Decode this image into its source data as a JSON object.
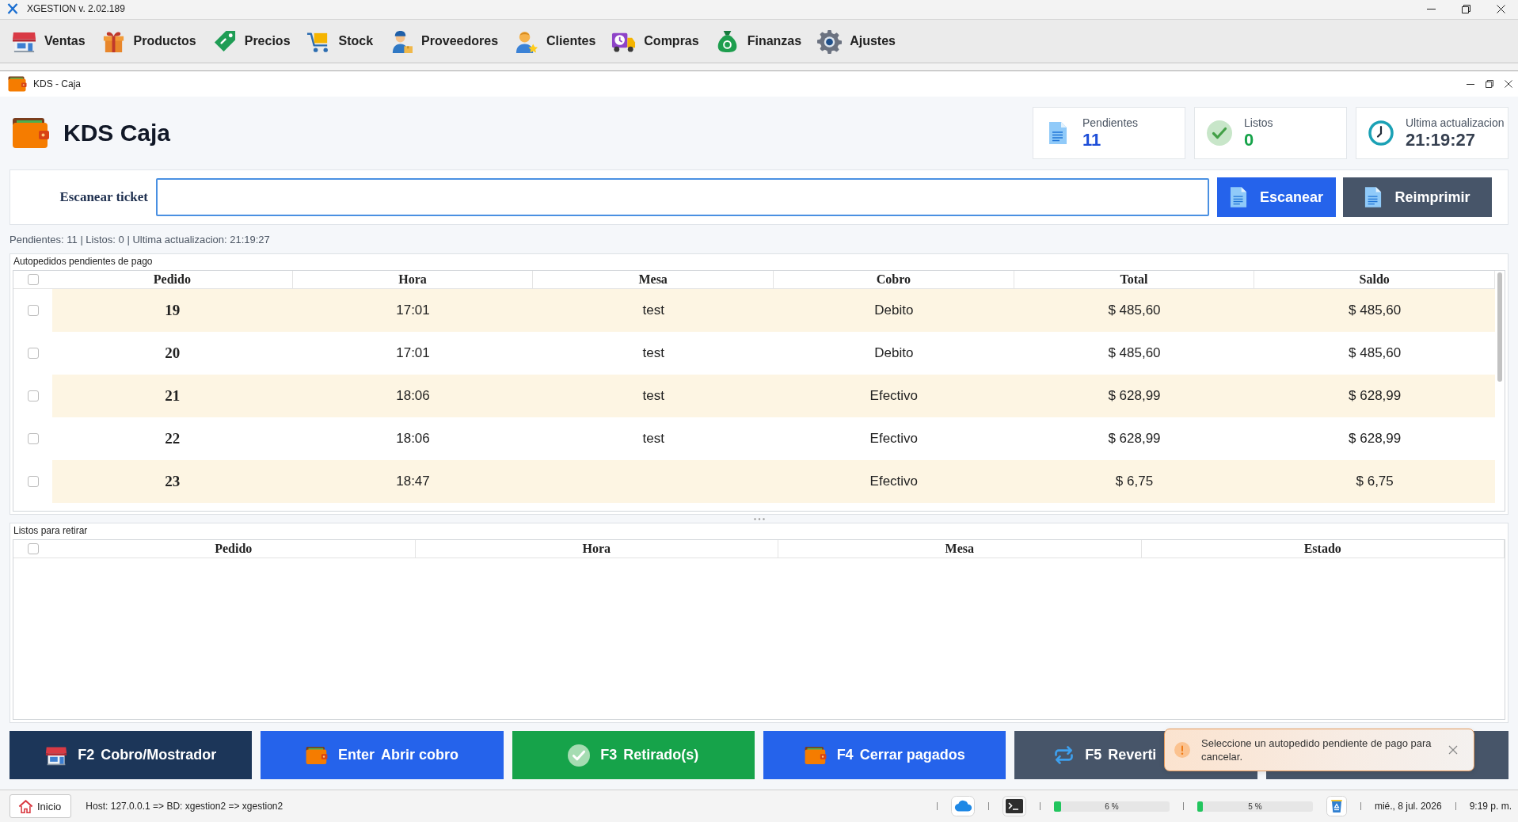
{
  "window": {
    "title": "XGESTION v. 2.02.189"
  },
  "menu": [
    {
      "label": "Ventas"
    },
    {
      "label": "Productos"
    },
    {
      "label": "Precios"
    },
    {
      "label": "Stock"
    },
    {
      "label": "Proveedores"
    },
    {
      "label": "Clientes"
    },
    {
      "label": "Compras"
    },
    {
      "label": "Finanzas"
    },
    {
      "label": "Ajustes"
    }
  ],
  "child_window": {
    "title": "KDS - Caja"
  },
  "header": {
    "title": "KDS Caja",
    "stats": [
      {
        "label": "Pendientes",
        "value": "11"
      },
      {
        "label": "Listos",
        "value": "0"
      },
      {
        "label": "Ultima actualizacion",
        "value": "21:19:27"
      }
    ]
  },
  "scan": {
    "label": "Escanear ticket",
    "focused": true,
    "buttons": [
      {
        "label": "Escanear",
        "color": "#2563eb"
      },
      {
        "label": "Reimprimir",
        "color": "#475569"
      }
    ]
  },
  "summary": "Pendientes: 11 | Listos: 0 | Ultima actualizacion: 21:19:27",
  "pending_table": {
    "title": "Autopedidos pendientes de pago",
    "select_all": {
      "checked": false
    },
    "columns": [
      "Pedido",
      "Hora",
      "Mesa",
      "Cobro",
      "Total",
      "Saldo"
    ],
    "rows": [
      {
        "checked": false,
        "pedido": "19",
        "hora": "17:01",
        "mesa": "test",
        "cobro": "Debito",
        "total": "$ 485,60",
        "saldo": "$ 485,60"
      },
      {
        "checked": false,
        "pedido": "20",
        "hora": "17:01",
        "mesa": "test",
        "cobro": "Debito",
        "total": "$ 485,60",
        "saldo": "$ 485,60"
      },
      {
        "checked": false,
        "pedido": "21",
        "hora": "18:06",
        "mesa": "test",
        "cobro": "Efectivo",
        "total": "$ 628,99",
        "saldo": "$ 628,99"
      },
      {
        "checked": false,
        "pedido": "22",
        "hora": "18:06",
        "mesa": "test",
        "cobro": "Efectivo",
        "total": "$ 628,99",
        "saldo": "$ 628,99"
      },
      {
        "checked": false,
        "pedido": "23",
        "hora": "18:47",
        "cobro": "Efectivo",
        "total": "$ 6,75",
        "saldo": "$ 6,75"
      }
    ]
  },
  "ready_table": {
    "title": "Listos para retirar",
    "select_all": {
      "checked": false
    },
    "columns": [
      "Pedido",
      "Hora",
      "Mesa",
      "Estado"
    ]
  },
  "actions": [
    {
      "key": "F2",
      "label": "Cobro/Mostrador",
      "color": "#1c3659"
    },
    {
      "key": "Enter",
      "label": "Abrir cobro",
      "color": "#2563eb"
    },
    {
      "key": "F3",
      "label": "Retirado(s)",
      "color": "#16a34a"
    },
    {
      "key": "F4",
      "label": "Cerrar pagados",
      "color": "#2563eb"
    },
    {
      "key": "F5",
      "label": "Reverti",
      "color": "#475569"
    },
    {
      "color": "#475569"
    }
  ],
  "toast": {
    "message": "Seleccione un autopedido pendiente de pago para cancelar."
  },
  "status_bar": {
    "home": "Inicio",
    "connection": "Host: 127.0.0.1 => BD: xgestion2 => xgestion2",
    "meters": [
      {
        "level": 0.06,
        "reading": "6 %"
      },
      {
        "level": 0.05,
        "reading": "5 %"
      }
    ],
    "date": "mié., 8 jul. 2026",
    "time": "9:19 p. m."
  }
}
